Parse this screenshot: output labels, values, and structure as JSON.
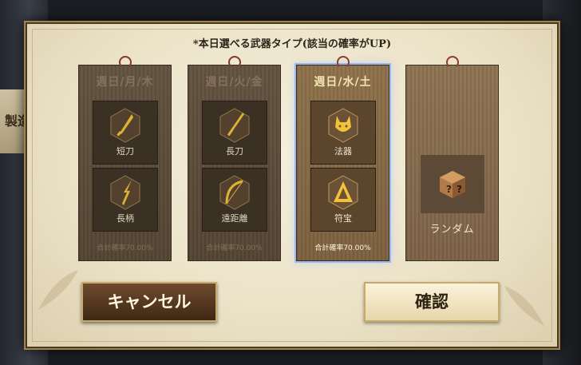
{
  "background": {
    "sign_text": "製造"
  },
  "dialog": {
    "title": "*本日選べる武器タイプ(該当の確率がUP)",
    "cards": [
      {
        "days": "週日/月/木",
        "weapons": [
          {
            "label": "短刀",
            "icon": "dagger-icon"
          },
          {
            "label": "長柄",
            "icon": "spear-icon"
          }
        ],
        "rate": "合計確率70.00%"
      },
      {
        "days": "週日/火/金",
        "weapons": [
          {
            "label": "長刀",
            "icon": "katana-icon"
          },
          {
            "label": "遠距離",
            "icon": "bow-icon"
          }
        ],
        "rate": "合計確率70.00%"
      },
      {
        "days": "週日/水/土",
        "weapons": [
          {
            "label": "法器",
            "icon": "fox-mask-icon"
          },
          {
            "label": "符宝",
            "icon": "talisman-icon"
          }
        ],
        "rate": "合計確率70.00%",
        "selected": true
      },
      {
        "label": "ランダム",
        "icon": "dice-icon"
      }
    ],
    "buttons": {
      "cancel": "キャンセル",
      "confirm": "確認"
    }
  },
  "colors": {
    "selected_outline": "#9fb6ee",
    "gold_icon": "#f2c23a",
    "frame": "#9c8350"
  }
}
